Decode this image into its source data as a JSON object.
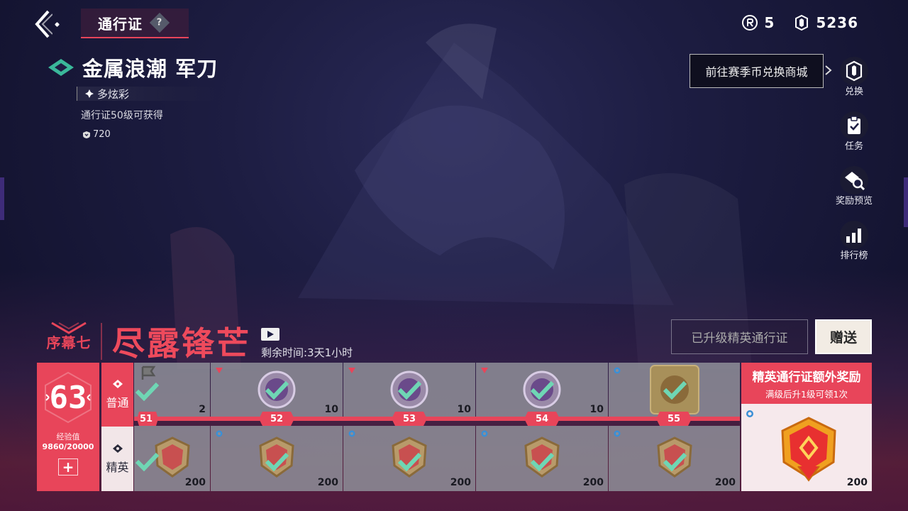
{
  "header": {
    "tab_label": "通行证",
    "help_glyph": "?"
  },
  "currencies": {
    "radianite": "5",
    "kingdom_credits": "5236"
  },
  "featured_item": {
    "name": "金属浪潮 军刀",
    "tier": "多炫彩",
    "unlock_note": "通行证50级可获得",
    "price": "720"
  },
  "side_menu": {
    "tooltip": "前往赛季币兑换商城",
    "items": [
      {
        "label": "兑换",
        "icon": "exchange-icon"
      },
      {
        "label": "任务",
        "icon": "mission-icon"
      },
      {
        "label": "奖励预览",
        "icon": "reward-preview-icon"
      },
      {
        "label": "排行榜",
        "icon": "leaderboard-icon"
      }
    ]
  },
  "chapter": {
    "number": "序幕七",
    "title": "尽露锋芒",
    "time_left": "剩余时间:3天1小时"
  },
  "actions": {
    "upgraded_label": "已升级精英通行证",
    "gift_label": "赠送"
  },
  "level": {
    "current": "63",
    "xp_label": "经验值",
    "xp_value": "9860/20000",
    "xp_fraction": 0.493,
    "plus_glyph": "+"
  },
  "tracks": {
    "normal_label": "普通",
    "elite_label": "精英"
  },
  "rewards": [
    {
      "level": "51",
      "normal_qty": "2",
      "elite_qty": "200",
      "normal_type": "flag",
      "claimed": true
    },
    {
      "level": "52",
      "normal_qty": "10",
      "elite_qty": "200",
      "normal_type": "coin",
      "claimed": true
    },
    {
      "level": "53",
      "normal_qty": "10",
      "elite_qty": "200",
      "normal_type": "coin",
      "claimed": true
    },
    {
      "level": "54",
      "normal_qty": "10",
      "elite_qty": "200",
      "normal_type": "coin",
      "claimed": true
    },
    {
      "level": "55",
      "normal_qty": "",
      "elite_qty": "200",
      "normal_type": "card",
      "claimed": true
    }
  ],
  "bonus": {
    "title": "精英通行证额外奖励",
    "subtitle": "满级后升1级可领1次",
    "qty": "200"
  },
  "colors": {
    "accent": "#e8455a",
    "check": "#6fd6b4",
    "rare": "#e8455a",
    "blue_rare": "#3a8fd6"
  }
}
